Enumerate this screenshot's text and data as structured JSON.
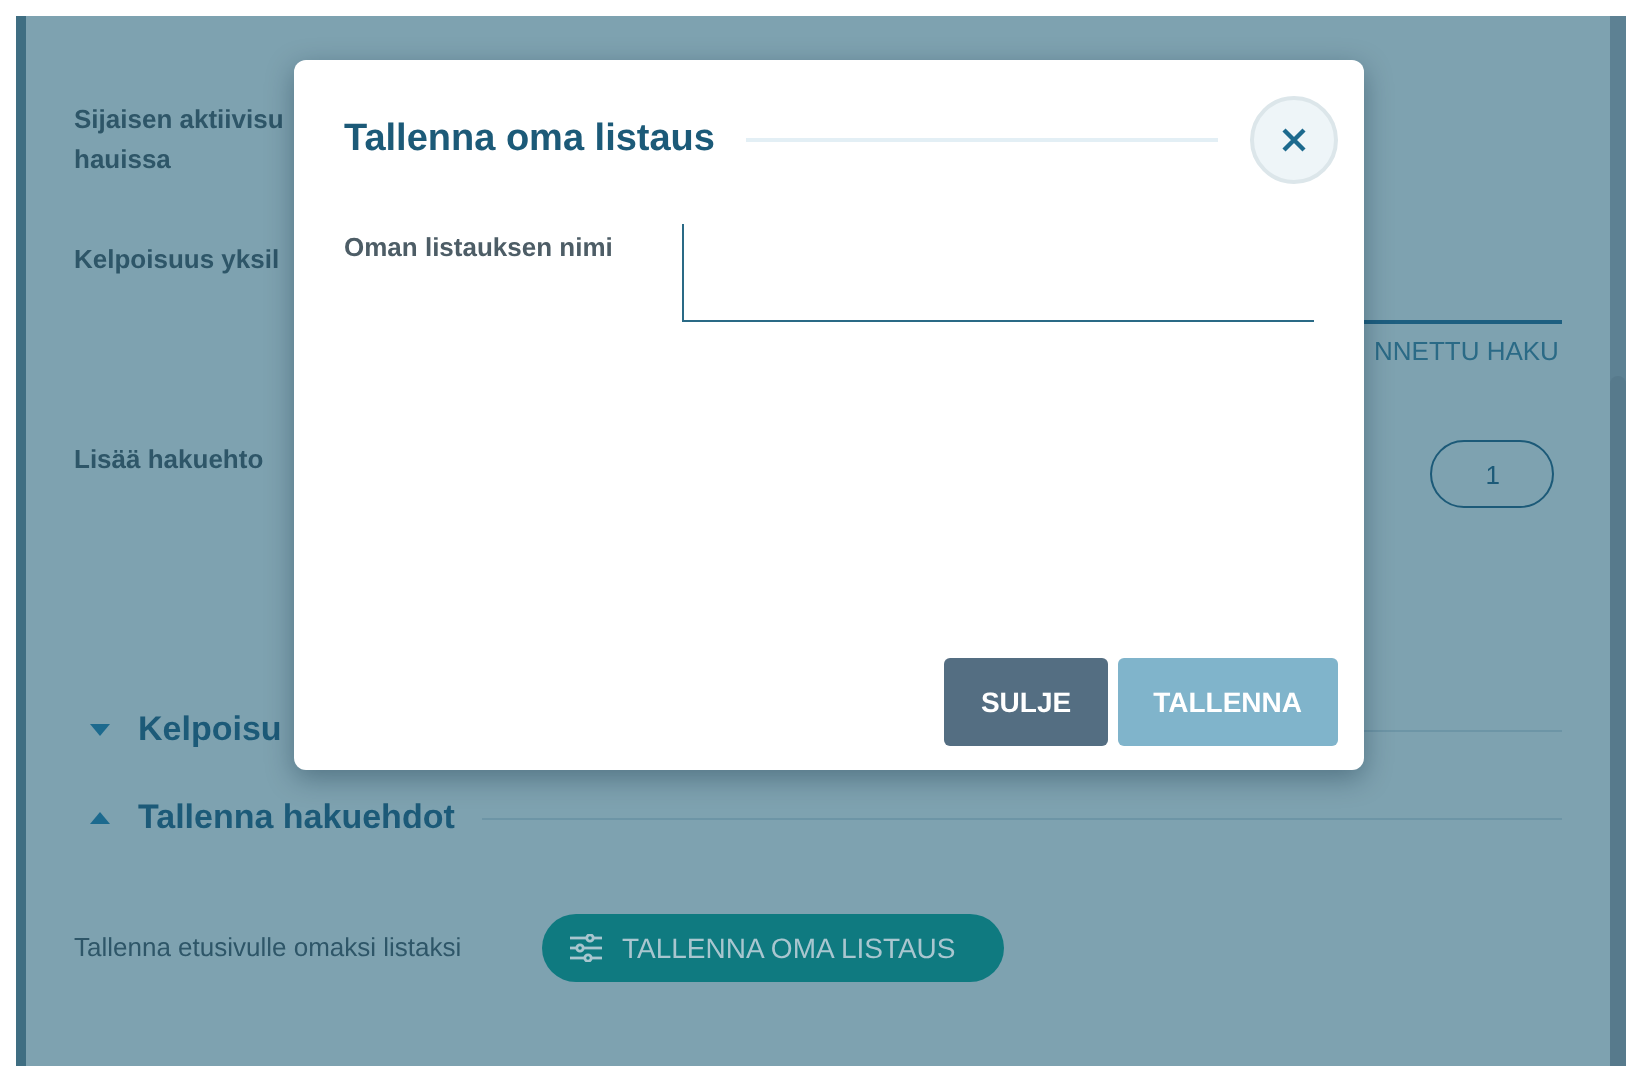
{
  "page": {
    "fields": [
      {
        "label": "Sijaisen aktiivisu",
        "label_line2": "hauissa"
      },
      {
        "label": "Kelpoisuus yksil"
      }
    ],
    "tab": {
      "label": "NNETTU HAKU",
      "selected": true
    },
    "add_filter": {
      "label": "Lisää hakuehto",
      "pill": "1"
    },
    "sections": [
      {
        "title": "Kelpoisu",
        "expanded": false
      },
      {
        "title": "Tallenna hakuehdot",
        "expanded": true
      }
    ],
    "save_row": {
      "label": "Tallenna etusivulle omaksi listaksi",
      "button": "TALLENNA OMA LISTAUS"
    }
  },
  "dialog": {
    "title": "Tallenna oma listaus",
    "field": {
      "label": "Oman listauksen nimi"
    },
    "buttons": [
      {
        "label": "SULJE",
        "kind": "secondary",
        "disabled": false
      },
      {
        "label": "TALLENNA",
        "kind": "primary",
        "disabled": true
      }
    ]
  }
}
